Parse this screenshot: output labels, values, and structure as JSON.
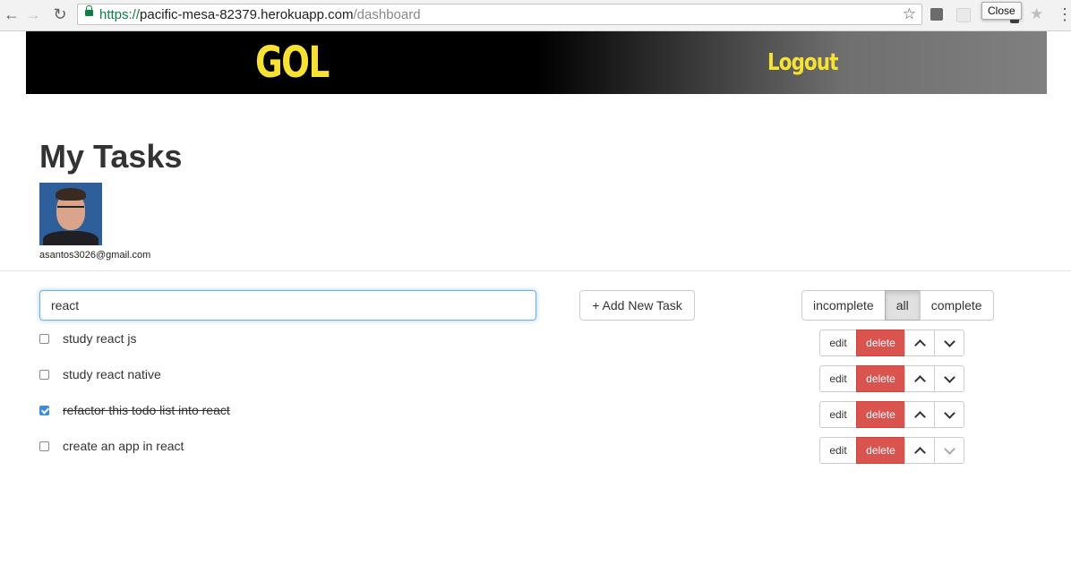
{
  "browser": {
    "url_scheme": "https://",
    "url_host": "pacific-mesa-82379.herokuapp.com",
    "url_path": "/dashboard",
    "tooltip": "Close"
  },
  "header": {
    "brand": "GOL",
    "logout_label": "Logout",
    "accent_color": "#f6e134"
  },
  "page": {
    "title": "My Tasks",
    "user_email": "asantos3026@gmail.com"
  },
  "search": {
    "value": "react"
  },
  "toolbar": {
    "add_label": "+ Add New Task",
    "filters": [
      {
        "label": "incomplete",
        "active": false
      },
      {
        "label": "all",
        "active": true
      },
      {
        "label": "complete",
        "active": false
      }
    ]
  },
  "tasks": [
    {
      "text": "study react js",
      "completed": false,
      "down_enabled": true
    },
    {
      "text": "study react native",
      "completed": false,
      "down_enabled": true
    },
    {
      "text": "refactor this todo list into react",
      "completed": true,
      "down_enabled": true
    },
    {
      "text": "create an app in react",
      "completed": false,
      "down_enabled": false
    }
  ],
  "task_actions": {
    "edit_label": "edit",
    "delete_label": "delete",
    "delete_color": "#d9534f"
  }
}
